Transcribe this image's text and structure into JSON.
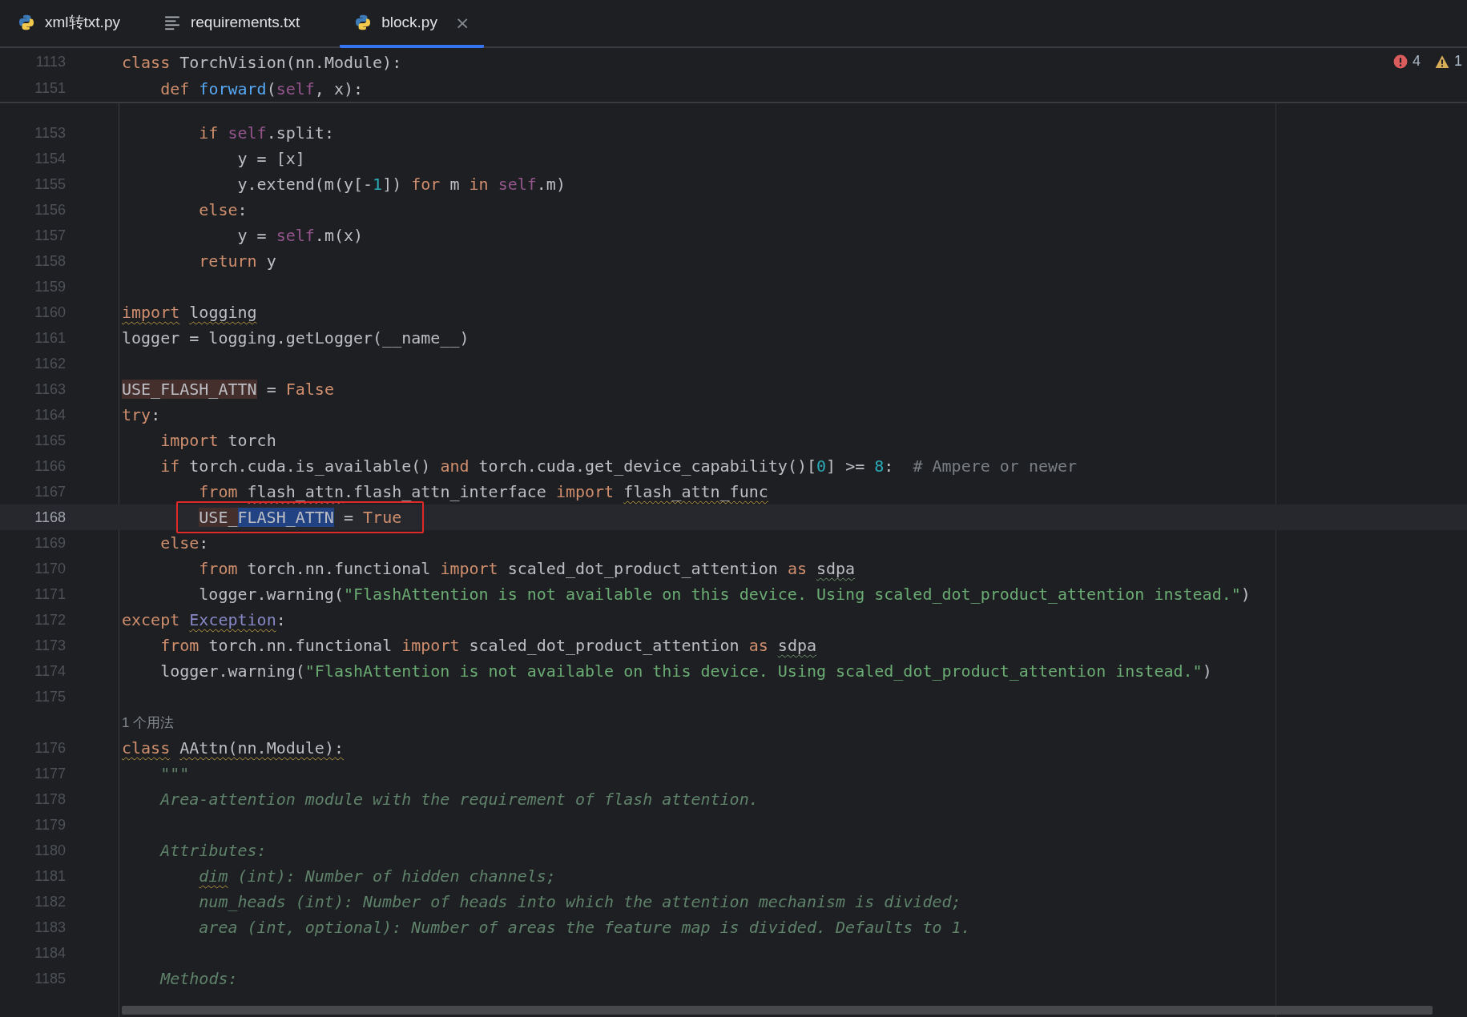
{
  "tabs": [
    {
      "label": "xml转txt.py",
      "kind": "python",
      "selected": false,
      "closable": false
    },
    {
      "label": "requirements.txt",
      "kind": "text",
      "selected": false,
      "closable": false
    },
    {
      "label": "block.py",
      "kind": "python",
      "selected": true,
      "closable": true,
      "close_glyph": "×"
    }
  ],
  "problems": {
    "errors": "4",
    "warnings": "1"
  },
  "sticky_lines": [
    {
      "number": "1113",
      "tokens": [
        {
          "text": "class",
          "kind": "kw"
        },
        {
          "text": " TorchVision(nn.Module):",
          "kind": "plain"
        }
      ]
    },
    {
      "number": "1151",
      "tokens": [
        {
          "text": "    def",
          "kind": "kw"
        },
        {
          "text": " forward",
          "kind": "fn"
        },
        {
          "text": "(",
          "kind": "plain"
        },
        {
          "text": "self",
          "kind": "self"
        },
        {
          "text": ", x):",
          "kind": "plain"
        }
      ]
    }
  ],
  "lines": [
    {
      "kind": "code",
      "number": "1153",
      "tokens": [
        {
          "text": "        if",
          "kind": "kw"
        },
        {
          "text": " self",
          "kind": "self"
        },
        {
          "text": ".split:",
          "kind": "plain"
        }
      ]
    },
    {
      "kind": "code",
      "number": "1154",
      "tokens": [
        {
          "text": "            y = [x]",
          "kind": "plain"
        }
      ]
    },
    {
      "kind": "code",
      "number": "1155",
      "tokens": [
        {
          "text": "            y.extend(m(y[-",
          "kind": "plain"
        },
        {
          "text": "1",
          "kind": "num"
        },
        {
          "text": "]) ",
          "kind": "plain"
        },
        {
          "text": "for",
          "kind": "kw"
        },
        {
          "text": " m ",
          "kind": "plain"
        },
        {
          "text": "in",
          "kind": "kw"
        },
        {
          "text": " self",
          "kind": "self"
        },
        {
          "text": ".m)",
          "kind": "plain"
        }
      ]
    },
    {
      "kind": "code",
      "number": "1156",
      "tokens": [
        {
          "text": "        else",
          "kind": "kw"
        },
        {
          "text": ":",
          "kind": "plain"
        }
      ]
    },
    {
      "kind": "code",
      "number": "1157",
      "tokens": [
        {
          "text": "            y = ",
          "kind": "plain"
        },
        {
          "text": "self",
          "kind": "self"
        },
        {
          "text": ".m(x)",
          "kind": "plain"
        }
      ]
    },
    {
      "kind": "code",
      "number": "1158",
      "tokens": [
        {
          "text": "        return",
          "kind": "kw"
        },
        {
          "text": " y",
          "kind": "plain"
        }
      ]
    },
    {
      "kind": "code",
      "number": "1159"
    },
    {
      "kind": "code",
      "number": "1160",
      "tokens": [
        {
          "text": "import",
          "kind": "kw",
          "warning": true
        },
        {
          "text": " logging",
          "kind": "plain",
          "warning": true
        }
      ]
    },
    {
      "kind": "code",
      "number": "1161",
      "tokens": [
        {
          "text": "logger = logging.getLogger(__name__)",
          "kind": "plain"
        }
      ]
    },
    {
      "kind": "code",
      "number": "1162"
    },
    {
      "kind": "code",
      "number": "1163",
      "tokens": [
        {
          "text": "USE_FLASH_ATTN",
          "kind": "plain",
          "usage_highlight": true
        },
        {
          "text": " = ",
          "kind": "plain"
        },
        {
          "text": "False",
          "kind": "kw"
        }
      ]
    },
    {
      "kind": "code",
      "number": "1164",
      "tokens": [
        {
          "text": "try",
          "kind": "kw"
        },
        {
          "text": ":",
          "kind": "plain"
        }
      ]
    },
    {
      "kind": "code",
      "number": "1165",
      "tokens": [
        {
          "text": "    import",
          "kind": "kw"
        },
        {
          "text": " torch",
          "kind": "plain"
        }
      ]
    },
    {
      "kind": "code",
      "number": "1166",
      "tokens": [
        {
          "text": "    if",
          "kind": "kw"
        },
        {
          "text": " torch.cuda.is_available() ",
          "kind": "plain"
        },
        {
          "text": "and",
          "kind": "kw"
        },
        {
          "text": " torch.cuda.get_device_capability()[",
          "kind": "plain"
        },
        {
          "text": "0",
          "kind": "num"
        },
        {
          "text": "] >= ",
          "kind": "plain"
        },
        {
          "text": "8",
          "kind": "num"
        },
        {
          "text": ":  ",
          "kind": "plain"
        },
        {
          "text": "# Ampere or newer",
          "kind": "comment"
        }
      ]
    },
    {
      "kind": "code",
      "number": "1167",
      "tokens": [
        {
          "text": "        from ",
          "kind": "kw"
        },
        {
          "text": "flash_attn",
          "kind": "plain",
          "error": true
        },
        {
          "text": ".flash_attn_interface ",
          "kind": "plain"
        },
        {
          "text": "import ",
          "kind": "kw"
        },
        {
          "text": "flash_attn_func",
          "kind": "plain",
          "warning": true
        }
      ]
    },
    {
      "kind": "code",
      "number": "1168",
      "current": true,
      "boxed": true,
      "tokens": [
        {
          "text": "        USE_",
          "kind": "plain",
          "usage_highlight": true
        },
        {
          "text": "FLASH_ATTN",
          "kind": "plain",
          "selected": true
        },
        {
          "text": " = ",
          "kind": "plain"
        },
        {
          "text": "True",
          "kind": "kw"
        }
      ]
    },
    {
      "kind": "code",
      "number": "1169",
      "tokens": [
        {
          "text": "    else",
          "kind": "kw"
        },
        {
          "text": ":",
          "kind": "plain"
        }
      ]
    },
    {
      "kind": "code",
      "number": "1170",
      "tokens": [
        {
          "text": "        from",
          "kind": "kw"
        },
        {
          "text": " torch.nn.functional ",
          "kind": "plain"
        },
        {
          "text": "import",
          "kind": "kw"
        },
        {
          "text": " scaled_dot_product_attention ",
          "kind": "plain"
        },
        {
          "text": "as ",
          "kind": "kw"
        },
        {
          "text": "sdpa",
          "kind": "plain",
          "typo": true
        }
      ]
    },
    {
      "kind": "code",
      "number": "1171",
      "tokens": [
        {
          "text": "        logger.warning(",
          "kind": "plain"
        },
        {
          "text": "\"FlashAttention is not available on this device. Using scaled_dot_product_attention instead.\"",
          "kind": "str"
        },
        {
          "text": ")",
          "kind": "plain"
        }
      ]
    },
    {
      "kind": "code",
      "number": "1172",
      "tokens": [
        {
          "text": "except ",
          "kind": "kw"
        },
        {
          "text": "Exception",
          "kind": "builtin",
          "warning": true
        },
        {
          "text": ":",
          "kind": "plain"
        }
      ]
    },
    {
      "kind": "code",
      "number": "1173",
      "tokens": [
        {
          "text": "    from",
          "kind": "kw"
        },
        {
          "text": " torch.nn.functional ",
          "kind": "plain"
        },
        {
          "text": "import",
          "kind": "kw"
        },
        {
          "text": " scaled_dot_product_attention ",
          "kind": "plain"
        },
        {
          "text": "as ",
          "kind": "kw"
        },
        {
          "text": "sdpa",
          "kind": "plain",
          "typo": true
        }
      ]
    },
    {
      "kind": "code",
      "number": "1174",
      "tokens": [
        {
          "text": "    logger.warning(",
          "kind": "plain"
        },
        {
          "text": "\"FlashAttention is not available on this device. Using scaled_dot_product_attention instead.\"",
          "kind": "str"
        },
        {
          "text": ")",
          "kind": "plain"
        }
      ]
    },
    {
      "kind": "code",
      "number": "1175"
    },
    {
      "kind": "usage_hint",
      "text": "1 个用法"
    },
    {
      "kind": "code",
      "number": "1176",
      "tokens": [
        {
          "text": "class",
          "kind": "kw",
          "warning": true
        },
        {
          "text": " AAttn(nn.Module):",
          "kind": "plain",
          "warning": true
        }
      ]
    },
    {
      "kind": "code",
      "number": "1177",
      "tokens": [
        {
          "text": "    \"\"\"",
          "kind": "doc"
        }
      ]
    },
    {
      "kind": "code",
      "number": "1178",
      "tokens": [
        {
          "text": "    Area-attention module with the requirement of flash attention.",
          "kind": "doc"
        }
      ]
    },
    {
      "kind": "code",
      "number": "1179"
    },
    {
      "kind": "code",
      "number": "1180",
      "tokens": [
        {
          "text": "    Attributes:",
          "kind": "doc"
        }
      ]
    },
    {
      "kind": "code",
      "number": "1181",
      "tokens": [
        {
          "text": "        dim",
          "kind": "doc",
          "warning": true
        },
        {
          "text": " (int): Number of hidden channels;",
          "kind": "doc"
        }
      ]
    },
    {
      "kind": "code",
      "number": "1182",
      "tokens": [
        {
          "text": "        num_heads (int): Number of heads into which the attention mechanism is divided;",
          "kind": "doc"
        }
      ]
    },
    {
      "kind": "code",
      "number": "1183",
      "tokens": [
        {
          "text": "        area (int, optional): Number of areas the feature map is divided. Defaults to 1.",
          "kind": "doc"
        }
      ]
    },
    {
      "kind": "code",
      "number": "1184"
    },
    {
      "kind": "code",
      "number": "1185",
      "tokens": [
        {
          "text": "    Methods:",
          "kind": "doc"
        }
      ]
    }
  ]
}
